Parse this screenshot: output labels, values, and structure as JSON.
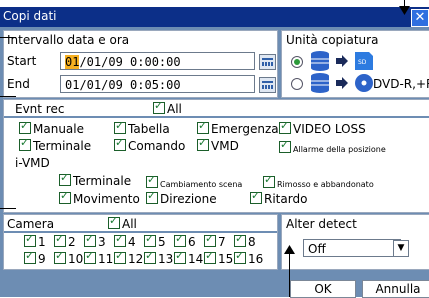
{
  "title": "Copi dati",
  "date_range": {
    "label": "Intervallo data e ora",
    "start_label": "Start",
    "start_day": "01",
    "start_rest": "/01/09  0:00:00",
    "end_label": "End",
    "end_value": "01/01/09  0:05:00"
  },
  "copy_unit": {
    "label": "Unità copiatura",
    "option2_label": "DVD-R,+R"
  },
  "event_rec": {
    "label": "Evnt rec",
    "all_label": "All",
    "items": [
      "Manuale",
      "Tabella",
      "Emergenza",
      "VIDEO LOSS",
      "Terminale",
      "Comando",
      "VMD",
      "Allarme della posizione"
    ],
    "ivmd_label": "i-VMD",
    "ivmd_items": [
      "Terminale",
      "Cambiamento scena",
      "Rimosso e abbandonato",
      "Movimento",
      "Direzione",
      "Ritardo"
    ]
  },
  "camera": {
    "label": "Camera",
    "all_label": "All",
    "numbers": [
      "1",
      "2",
      "3",
      "4",
      "5",
      "6",
      "7",
      "8",
      "9",
      "10",
      "11",
      "12",
      "13",
      "14",
      "15",
      "16"
    ]
  },
  "alter_detect": {
    "label": "Alter detect",
    "selected": "Off"
  },
  "buttons": {
    "ok": "OK",
    "cancel": "Annulla"
  }
}
